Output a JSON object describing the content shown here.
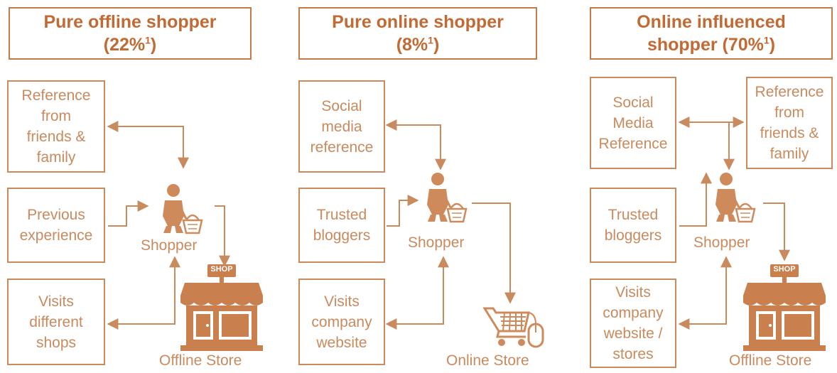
{
  "panels": [
    {
      "title_line1": "Pure offline shopper",
      "title_line2": "(22%",
      "title_sup": "1",
      "title_close": ")",
      "boxes": [
        {
          "lines": [
            "Reference",
            "from",
            "friends &",
            "family"
          ]
        },
        {
          "lines": [
            "Previous",
            "experience"
          ]
        },
        {
          "lines": [
            "Visits",
            "different",
            "shops"
          ]
        }
      ],
      "shopper_label": "Shopper",
      "store_label": "Offline Store",
      "store_sign": "SHOP",
      "store_icon": "shop-icon"
    },
    {
      "title_line1": "Pure online shopper",
      "title_line2": "(8%",
      "title_sup": "1",
      "title_close": ")",
      "boxes": [
        {
          "lines": [
            "Social",
            "media",
            "reference"
          ]
        },
        {
          "lines": [
            "Trusted",
            "bloggers"
          ]
        },
        {
          "lines": [
            "Visits",
            "company",
            "website"
          ]
        }
      ],
      "shopper_label": "Shopper",
      "store_label": "Online Store",
      "store_icon": "cart-mouse-icon"
    },
    {
      "title_line1": "Online influenced",
      "title_line2": "shopper (70%",
      "title_sup": "1",
      "title_close": ")",
      "boxes": [
        {
          "lines": [
            "Social",
            "Media",
            "Reference"
          ]
        },
        {
          "lines": [
            "Reference",
            "from",
            "friends &",
            "family"
          ]
        },
        {
          "lines": [
            "Trusted",
            "bloggers"
          ]
        },
        {
          "lines": [
            "Visits",
            "company",
            "website /",
            "stores"
          ]
        }
      ],
      "shopper_label": "Shopper",
      "store_label": "Offline Store",
      "store_sign": "SHOP",
      "store_icon": "shop-icon"
    }
  ],
  "colors": {
    "title": "#c26a34",
    "box": "#c98a5e",
    "icon": "#cf8a5c"
  },
  "shopper_icon": "shopper-icon"
}
